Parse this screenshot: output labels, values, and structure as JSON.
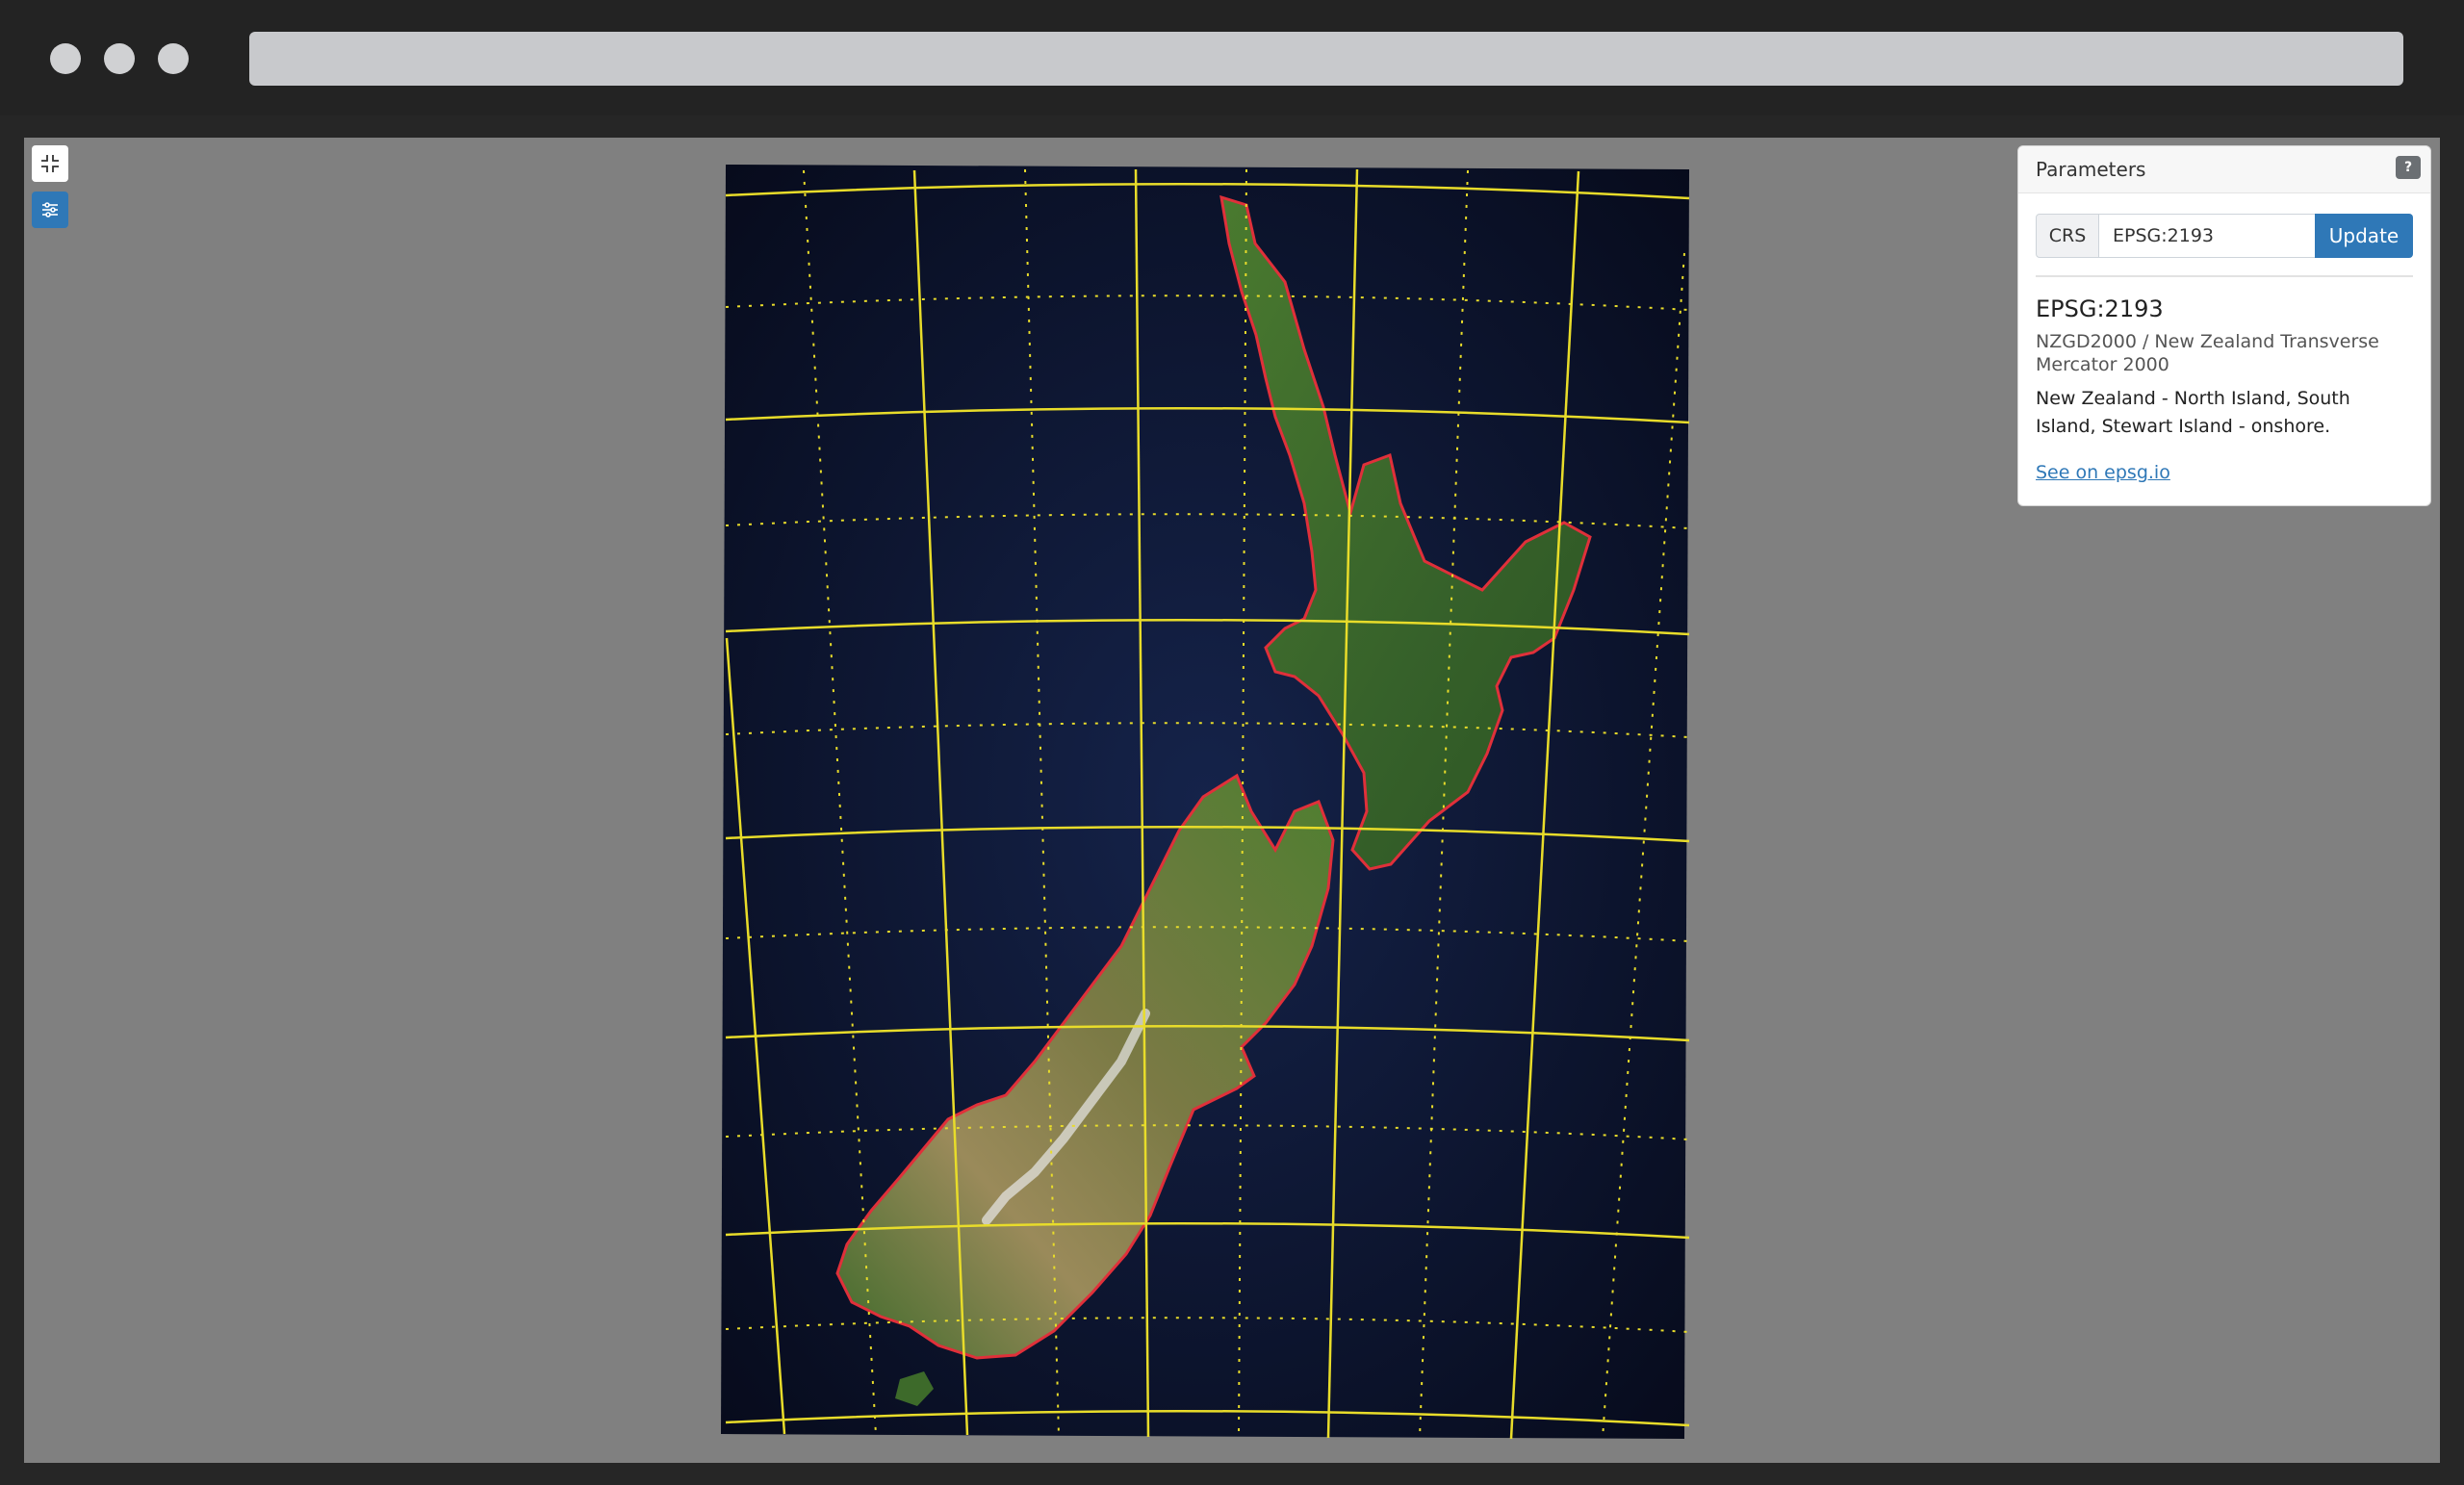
{
  "window": {
    "traffic_lights": [
      "close",
      "minimize",
      "maximize"
    ],
    "address_bar": ""
  },
  "map_controls": {
    "exit_fullscreen_icon": "exit-fullscreen-icon",
    "settings_icon": "sliders-icon"
  },
  "map": {
    "graticule_color": "#e8dc2a",
    "boundary_color": "#e0303a",
    "ocean_color": "#0b1430",
    "land_color": "#3d6a2a"
  },
  "parameters": {
    "title": "Parameters",
    "help_label": "?",
    "crs_label": "CRS",
    "crs_value": "EPSG:2193",
    "update_label": "Update",
    "code": "EPSG:2193",
    "name": "NZGD2000 / New Zealand Transverse Mercator 2000",
    "area": "New Zealand - North Island, South Island, Stewart Island - onshore.",
    "link_label": "See on epsg.io"
  }
}
